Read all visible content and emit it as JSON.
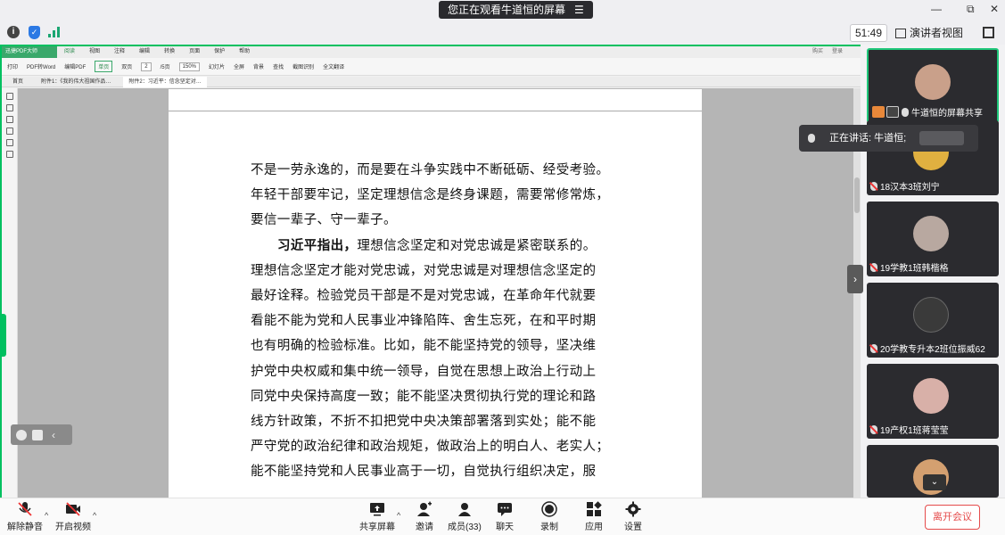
{
  "banner": {
    "text": "您正在观看牛道恒的屏幕",
    "menu_icon": "menu-icon"
  },
  "window_controls": {
    "minimize": "—",
    "restore": "⧉",
    "close": "✕"
  },
  "topbar": {
    "timer": "51:49",
    "view_label": "演讲者视图"
  },
  "wps": {
    "app_name": "迅捷PDF大师",
    "menu": [
      "阅读",
      "视图",
      "注释",
      "编辑",
      "转换",
      "页面",
      "保护",
      "帮助"
    ],
    "menu_active": "阅读",
    "right_items": [
      "购买",
      "登录"
    ],
    "toolbar": {
      "print": "打印",
      "pdf2word": "PDF转Word",
      "edit_pdf": "编辑PDF",
      "single": "单页",
      "double": "双页",
      "page_num": "2",
      "page_total": "/5页",
      "zoom": "150%",
      "slideshow": "幻灯片",
      "fullscreen": "全屏",
      "background": "背景",
      "find": "查找",
      "screenshot": "截图识别",
      "translate": "全文翻译"
    },
    "tabs": [
      {
        "label": "首页"
      },
      {
        "label": "附件1：《我的伟大祖国作品…"
      },
      {
        "label": "附件2：习近平：信念坚定对…"
      }
    ]
  },
  "document": {
    "lines": [
      "不是一劳永逸的，而是要在斗争实践中不断砥砺、经受考验。",
      "年轻干部要牢记，坚定理想信念是终身课题，需要常修常炼，",
      "要信一辈子、守一辈子。",
      "",
      "理想信念坚定才能对党忠诚，对党忠诚是对理想信念坚定的",
      "最好诠释。检验党员干部是不是对党忠诚，在革命年代就要",
      "看能不能为党和人民事业冲锋陷阵、舍生忘死，在和平时期",
      "也有明确的检验标准。比如，能不能坚持党的领导，坚决维",
      "护党中央权威和集中统一领导，自觉在思想上政治上行动上",
      "同党中央保持高度一致；能不能坚决贯彻执行党的理论和路",
      "线方针政策，不折不扣把党中央决策部署落到实处；能不能",
      "严守党的政治纪律和政治规矩，做政治上的明白人、老实人；",
      "能不能坚持党和人民事业高于一切，自觉执行组织决定，服"
    ],
    "para_bold": "习近平指出，",
    "para_rest": "理想信念坚定和对党忠诚是紧密联系的。"
  },
  "participants": [
    {
      "name": "牛道恒的屏幕共享",
      "avatar_color": "#c9a08a",
      "active": true
    },
    {
      "name": "18汉本3班刘宁",
      "avatar_color": "#e0b040"
    },
    {
      "name": "19学教1班韩楷格",
      "avatar_color": "#b8a8a0"
    },
    {
      "name": "20学教专升本2班位振威62",
      "avatar_color": "#3a3a3a"
    },
    {
      "name": "19产权1班蒋莹莹",
      "avatar_color": "#d8b0a8"
    },
    {
      "name": "",
      "avatar_color": "#d4a070"
    }
  ],
  "speaking": {
    "label": "正在讲话: 牛道恒;"
  },
  "bottombar": {
    "unmute": "解除静音",
    "video": "开启视频",
    "share": "共享屏幕",
    "invite": "邀请",
    "members": "成员(33)",
    "chat": "聊天",
    "record": "录制",
    "apps": "应用",
    "settings": "设置",
    "leave": "离开会议"
  },
  "colors": {
    "accent": "#00c060",
    "leave": "#e54b4b",
    "tile_bg": "#2b2b2f"
  }
}
